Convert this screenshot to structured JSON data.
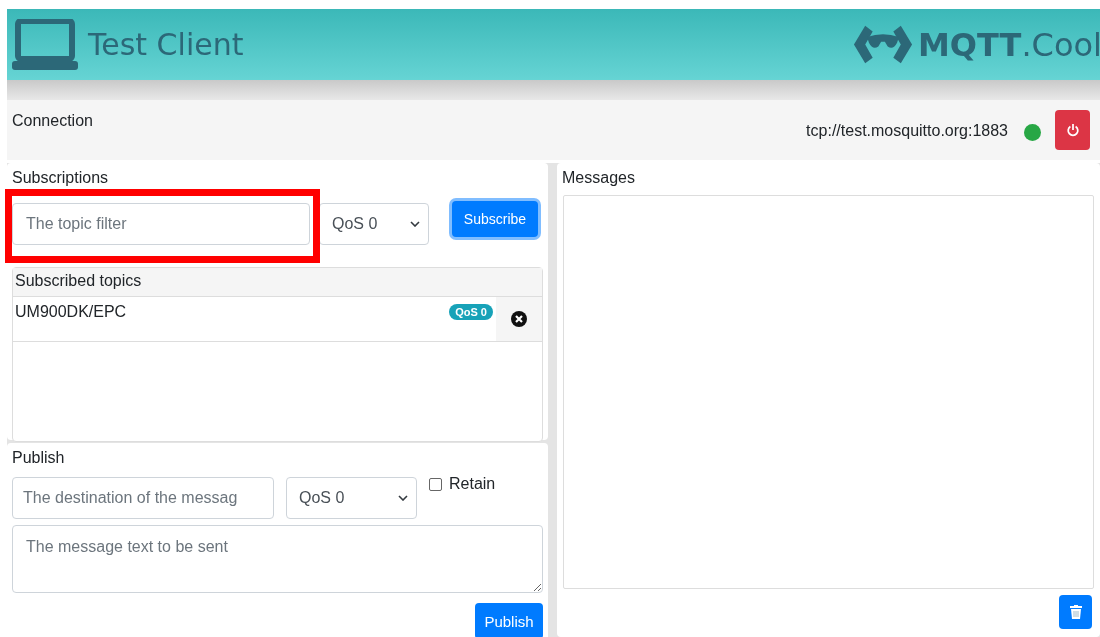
{
  "header": {
    "title": "Test Client",
    "logo": "**MQTT**.Cool"
  },
  "connection": {
    "title": "Connection",
    "url": "tcp://test.mosquitto.org:1883",
    "connected": true
  },
  "subscriptions": {
    "title": "Subscriptions",
    "topic_placeholder": "The topic filter",
    "qos": "QoS 0",
    "button": "Subscribe",
    "highlighted": true,
    "list_title": "Subscribed topics",
    "topics": [
      {
        "topic": "UM900DK/EPC",
        "qos": "QoS 0"
      }
    ]
  },
  "publish": {
    "title": "Publish",
    "destination_placeholder": "The destination of the messag",
    "qos": "QoS 0",
    "retain": {
      "label": "Retain",
      "checked": false
    },
    "message_placeholder": "The message text to be sent",
    "button": "Publish"
  },
  "messages": {
    "title": "Messages"
  }
}
